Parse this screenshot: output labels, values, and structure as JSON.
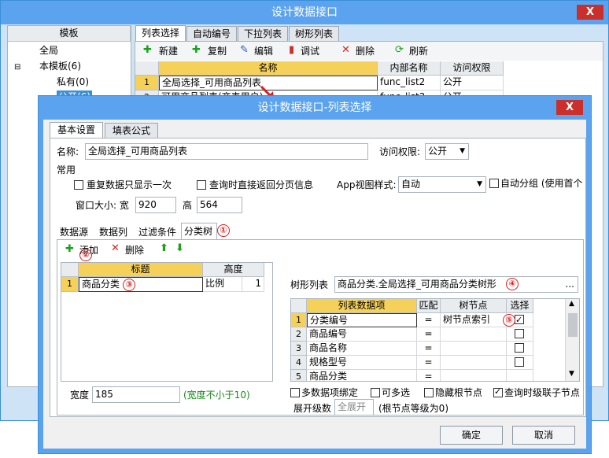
{
  "back_window": {
    "title": "设计数据接口",
    "close": "X",
    "tree_header": "模板",
    "tree": [
      "全局",
      "本模板(6)",
      "私有(0)",
      "公开(6)"
    ],
    "tabs": [
      "列表选择",
      "自动编号",
      "下拉列表",
      "树形列表"
    ],
    "toolbar": [
      "新建",
      "复制",
      "编辑",
      "调试",
      "删除",
      "刷新"
    ],
    "grid_headers": [
      "名称",
      "内部名称",
      "访问权限"
    ],
    "rows": [
      {
        "num": "1",
        "name": "全局选择_可用商品列表",
        "inner": "func_list2",
        "access": "公开"
      },
      {
        "num": "2",
        "name": "可用商品列表(商表用户)",
        "inner": "func_list3",
        "access": "公开"
      }
    ]
  },
  "dialog": {
    "title": "设计数据接口-列表选择",
    "close": "X",
    "tabs": [
      "基本设置",
      "填表公式"
    ],
    "name_label": "名称:",
    "name_value": "全局选择_可用商品列表",
    "access_label": "访问权限:",
    "access_value": "公开",
    "group_label": "常用",
    "cb_repeat": "重复数据只显示一次",
    "cb_direct_return": "查询时直接返回分页信息",
    "app_view_label": "App视图样式:",
    "app_view_value": "自动",
    "cb_auto_group": "自动分组 (使用首个",
    "window_size_label": "窗口大小: 宽",
    "width_value": "920",
    "height_label": "高",
    "height_value": "564",
    "subtabs": [
      "数据源",
      "数据列",
      "过滤条件",
      "分类树"
    ],
    "add_label": "添加",
    "delete_label": "删除",
    "left_grid": {
      "headers": [
        "标题",
        "高度"
      ],
      "row": {
        "num": "1",
        "title": "商品分类",
        "height_mode": "比例",
        "height_value": "1"
      }
    },
    "width_label": "宽度",
    "width_field": "185",
    "width_hint": "(宽度不小于10)",
    "tree_list_label": "树形列表",
    "tree_list_value": "商品分类.全局选择_可用商品分类树形",
    "tree_list_btn": "...",
    "right_grid": {
      "headers": [
        "列表数据项",
        "匹配",
        "树节点",
        "选择"
      ],
      "rows": [
        {
          "num": "1",
          "item": "分类编号",
          "match": "=",
          "node": "树节点索引",
          "checked": true
        },
        {
          "num": "2",
          "item": "商品编号",
          "match": "=",
          "node": "",
          "checked": false
        },
        {
          "num": "3",
          "item": "商品名称",
          "match": "=",
          "node": "",
          "checked": false
        },
        {
          "num": "4",
          "item": "规格型号",
          "match": "=",
          "node": "",
          "checked": false
        },
        {
          "num": "5",
          "item": "商品分类",
          "match": "=",
          "node": "",
          "checked": false
        }
      ]
    },
    "cb_multi_bind": "多数据项绑定",
    "cb_multi_select": "可多选",
    "cb_hide_root": "隐藏根节点",
    "cb_query_children": "查询时级联子节点",
    "expand_label": "展开级数",
    "expand_placeholder": "全展开",
    "expand_hint": "(根节点等级为0)",
    "ok": "确定",
    "cancel": "取消"
  },
  "badges": [
    "①",
    "②",
    "③",
    "④",
    "⑤"
  ],
  "colors": {
    "titlebar": "#5ba3ee",
    "close": "#c9302c",
    "selected_header": "#f6d15a",
    "badge": "#e01c1c"
  }
}
